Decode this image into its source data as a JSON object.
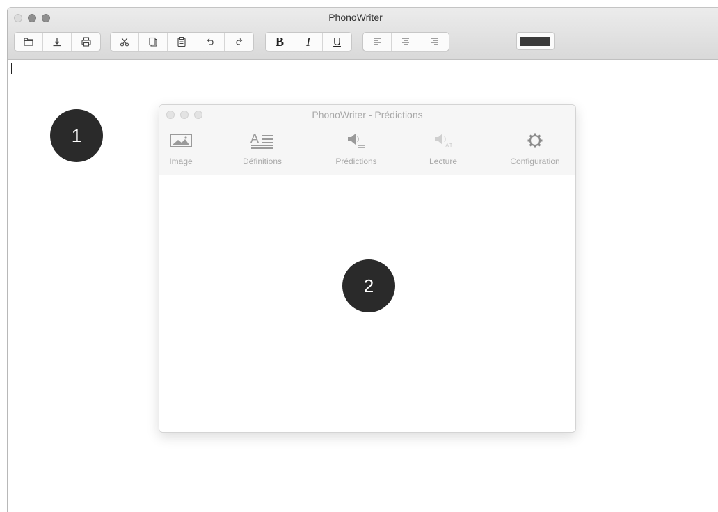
{
  "main_window": {
    "title": "PhonoWriter",
    "toolbar": {
      "file_buttons": [
        "open-icon",
        "save-icon",
        "print-icon"
      ],
      "edit_buttons": [
        "cut-icon",
        "copy-icon",
        "paste-icon",
        "undo-icon",
        "redo-icon"
      ],
      "format_buttons": {
        "bold_label": "B",
        "italic_label": "I",
        "underline_label": "U"
      },
      "align_buttons": [
        "align-left-icon",
        "align-center-icon",
        "align-right-icon"
      ],
      "text_color": "#3a3a3a"
    }
  },
  "predictions_window": {
    "title": "PhonoWriter - Prédictions",
    "tabs": [
      {
        "label": "Image",
        "icon": "image-icon"
      },
      {
        "label": "Définitions",
        "icon": "definitions-icon"
      },
      {
        "label": "Prédictions",
        "icon": "predictions-speaker-icon"
      },
      {
        "label": "Lecture",
        "icon": "reading-speaker-icon"
      },
      {
        "label": "Configuration",
        "icon": "gear-icon"
      }
    ]
  },
  "callouts": {
    "badge_1": "1",
    "badge_2": "2"
  }
}
